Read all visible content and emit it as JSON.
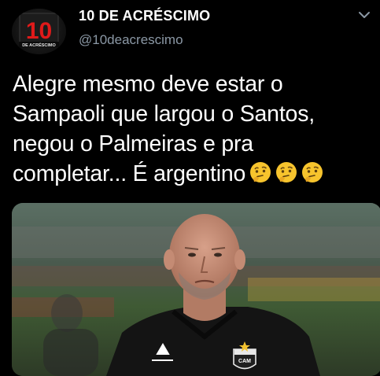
{
  "profile": {
    "display_name": "10 DE ACRÉSCIMO",
    "handle": "@10deacrescimo",
    "avatar_text": "10",
    "avatar_subtext": "DE ACRÉSCIMO"
  },
  "tweet": {
    "text": "Alegre mesmo deve estar o\nSampaoli que largou o Santos,\nnegou o Palmeiras e pra\ncompletar... É argentino",
    "emojis": [
      "thinking-face",
      "thinking-face",
      "thinking-face"
    ]
  },
  "media": {
    "image_icon": "photo-of-coach-in-black-shirt",
    "jersey_badge": "CAM"
  },
  "colors": {
    "background": "#000000",
    "text": "#ffffff",
    "secondary_text": "#8b98a5",
    "emoji_yellow": "#f7c42d",
    "avatar_red": "#e01a1a"
  }
}
